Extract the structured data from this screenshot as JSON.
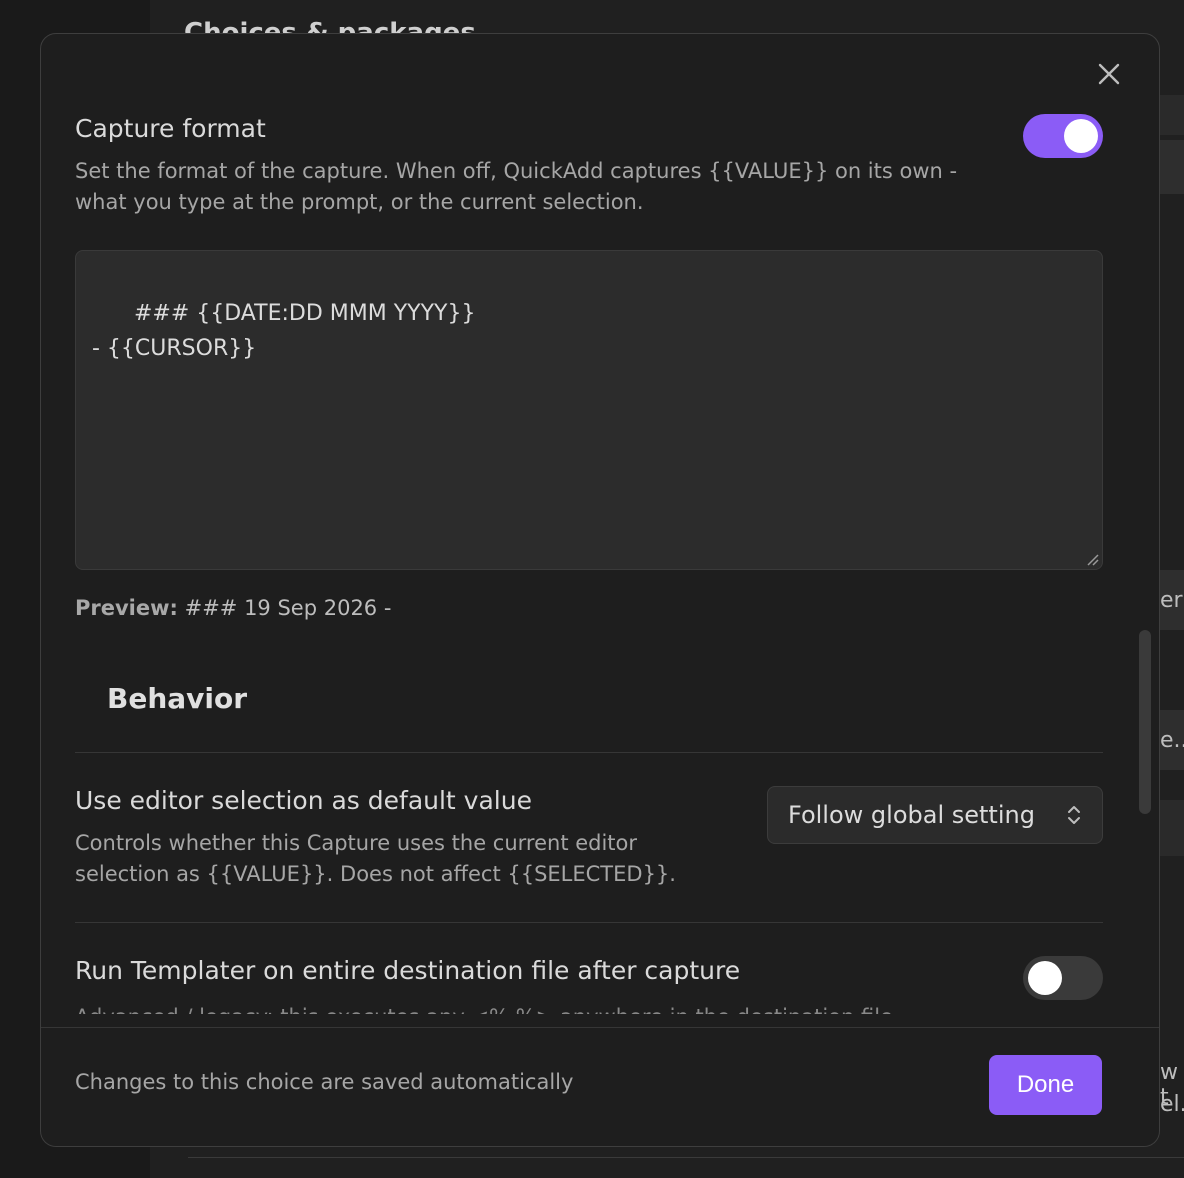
{
  "background": {
    "title": "Choices & packages",
    "right_fragments": [
      "er",
      "e...",
      "w t",
      "el."
    ]
  },
  "modal": {
    "capture_format": {
      "name": "Capture format",
      "description": "Set the format of the capture. When off, QuickAdd captures {{VALUE}} on its own - what you type at the prompt, or the current selection.",
      "enabled": true,
      "value": "### {{DATE:DD MMM YYYY}}\n- {{CURSOR}}",
      "preview_label": "Preview:",
      "preview_value": "### 19 Sep 2026 -"
    },
    "behavior": {
      "heading": "Behavior",
      "editor_selection": {
        "name": "Use editor selection as default value",
        "description": "Controls whether this Capture uses the current editor selection as {{VALUE}}. Does not affect {{SELECTED}}.",
        "selected_option": "Follow global setting"
      },
      "run_templater": {
        "name": "Run Templater on entire destination file after capture",
        "description": "Advanced / legacy: this executes any <% %> anywhere in the destination file",
        "enabled": false
      }
    },
    "footer": {
      "note": "Changes to this choice are saved automatically",
      "done_label": "Done"
    }
  },
  "colors": {
    "accent": "#8b5cf6",
    "modal_bg": "#1e1e1e",
    "page_bg": "#1a1a1a"
  }
}
